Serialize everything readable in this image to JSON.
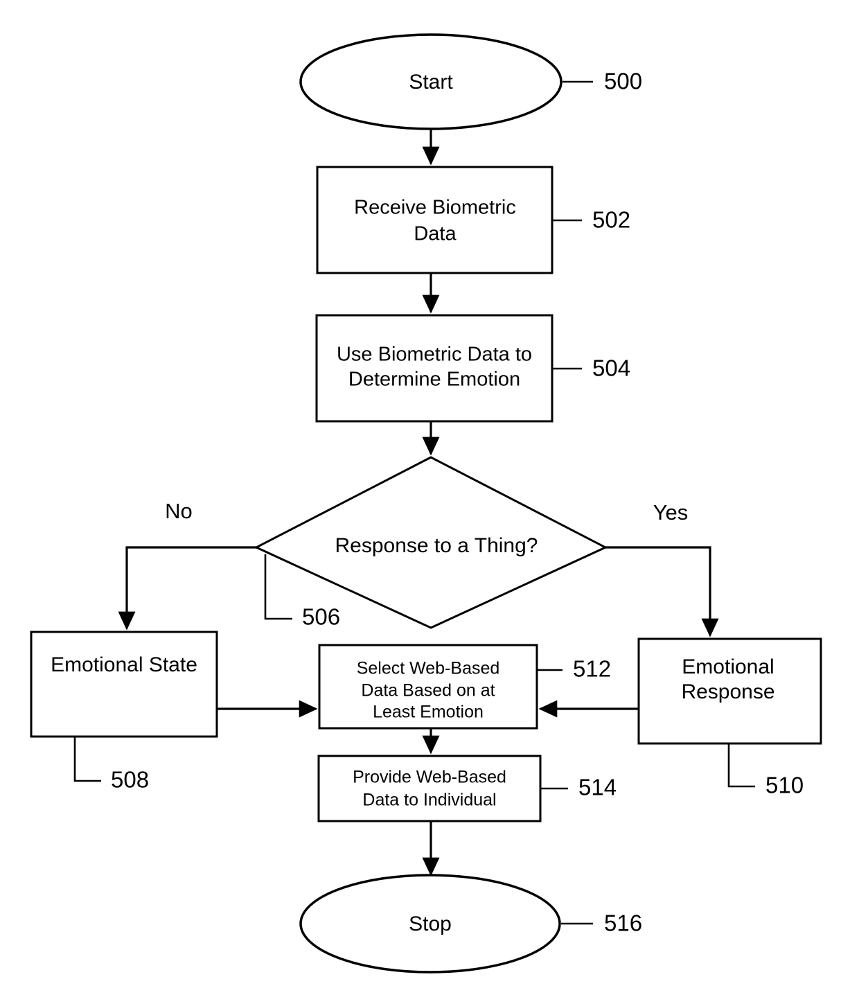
{
  "figure": {
    "type": "flowchart",
    "background_color": "#ffffff",
    "line_color": "#000000"
  },
  "nodes": {
    "start": {
      "label": "Start",
      "ref": "500",
      "shape": "ellipse"
    },
    "receive_biometric": {
      "line1": "Receive Biometric",
      "line2": "Data",
      "ref": "502",
      "shape": "rect"
    },
    "determine_emotion": {
      "line1": "Use Biometric Data to",
      "line2": "Determine Emotion",
      "ref": "504",
      "shape": "rect"
    },
    "decision": {
      "label": "Response to a Thing?",
      "ref": "506",
      "shape": "diamond"
    },
    "emotional_state": {
      "label": "Emotional State",
      "ref": "508",
      "shape": "rect"
    },
    "emotional_response": {
      "line1": "Emotional",
      "line2": "Response",
      "ref": "510",
      "shape": "rect"
    },
    "select_web_data": {
      "line1": "Select Web-Based",
      "line2": "Data Based on at",
      "line3": "Least Emotion",
      "ref": "512",
      "shape": "rect"
    },
    "provide_web_data": {
      "line1": "Provide Web-Based",
      "line2": "Data to Individual",
      "ref": "514",
      "shape": "rect"
    },
    "stop": {
      "label": "Stop",
      "ref": "516",
      "shape": "ellipse"
    }
  },
  "branches": {
    "no_label": "No",
    "yes_label": "Yes"
  }
}
